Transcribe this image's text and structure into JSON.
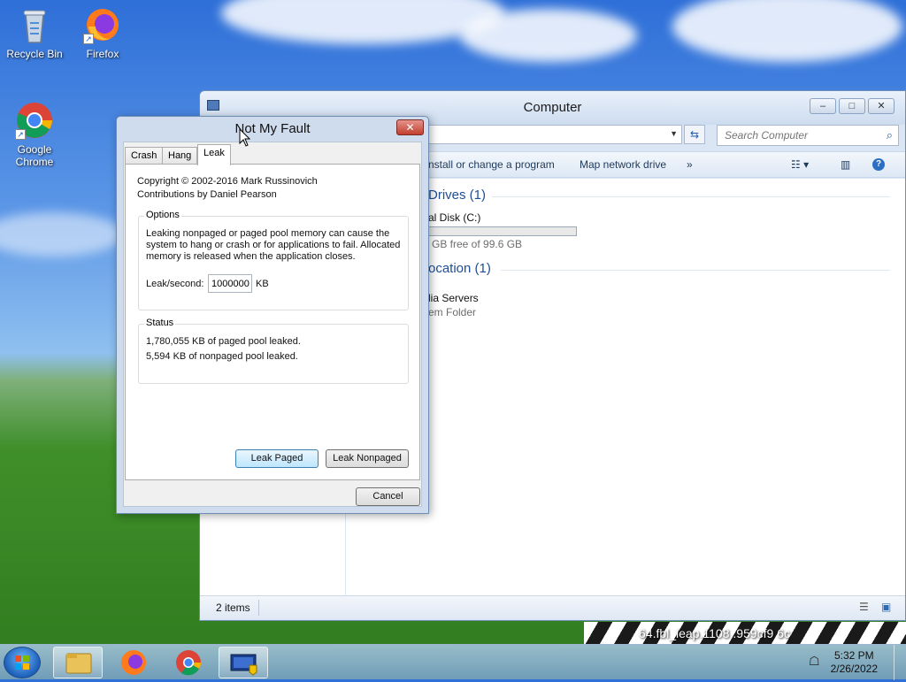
{
  "desktop": {
    "icons": [
      {
        "label": "Recycle Bin"
      },
      {
        "label": "Firefox"
      },
      {
        "label": "Google Chrome"
      }
    ],
    "watermark_text": "64.fbl_leap.1108 .959cf9 6c"
  },
  "explorer": {
    "title": "Computer",
    "search_placeholder": "Search Computer",
    "toolbar": {
      "uninstall_label": "nstall or change a program",
      "map_drive_label": "Map network drive",
      "more_label": "»"
    },
    "groups": {
      "drives_title": "Drives (1)",
      "drive_name": "al Disk (C:)",
      "drive_free": "GB free of 99.6 GB",
      "drive_used_fraction": 0.0,
      "location_title": "ocation (1)",
      "media_name": "lia Servers",
      "media_type": "em Folder"
    },
    "status_items": "2 items"
  },
  "dialog": {
    "title": "Not My Fault",
    "close_label": "✕",
    "tabs": [
      {
        "label": "Crash"
      },
      {
        "label": "Hang"
      },
      {
        "label": "Leak"
      }
    ],
    "copyright": "Copyright © 2002-2016 Mark Russinovich",
    "contributions": "Contributions by Daniel Pearson",
    "options_label": "Options",
    "options_text_1": "Leaking nonpaged or paged pool memory can cause the",
    "options_text_2": "system to hang or crash or for applications to fail. Allocated",
    "options_text_3": "memory is released when the application closes.",
    "leak_label": "Leak/second:",
    "leak_value": "1000000",
    "leak_unit": "KB",
    "status_label": "Status",
    "status_line_1": "1,780,055 KB of paged pool leaked.",
    "status_line_2": "5,594 KB of nonpaged pool leaked.",
    "leak_paged_btn": "Leak Paged",
    "leak_nonpaged_btn": "Leak Nonpaged",
    "cancel_btn": "Cancel"
  },
  "taskbar": {
    "time": "5:32 PM",
    "date": "2/26/2022"
  }
}
